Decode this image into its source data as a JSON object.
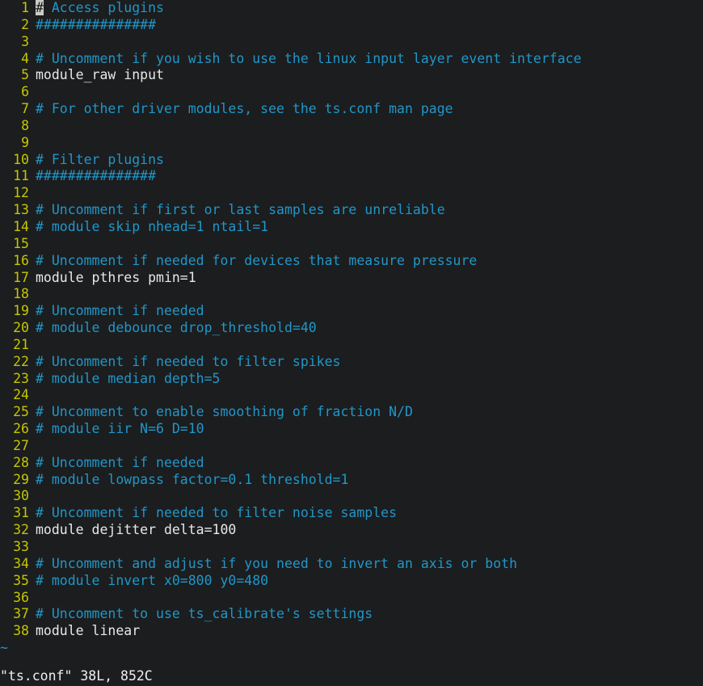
{
  "terminal": {
    "background_color": "#1b1d1e",
    "foreground_color": "#e8e8e8",
    "linenumber_color": "#c6c600",
    "comment_color": "#2196c9",
    "cursor_color": "#c9ccc7"
  },
  "editor": {
    "name": "vim",
    "cursor": {
      "line": 1,
      "column": 1,
      "character": "#"
    },
    "end_of_buffer_marker": "~",
    "lines": [
      {
        "n": "1",
        "text": "# Access plugins",
        "kind": "comment",
        "cursor_at_col": 0
      },
      {
        "n": "2",
        "text": "###############",
        "kind": "comment"
      },
      {
        "n": "3",
        "text": "",
        "kind": "empty"
      },
      {
        "n": "4",
        "text": "# Uncomment if you wish to use the linux input layer event interface",
        "kind": "comment"
      },
      {
        "n": "5",
        "text": "module_raw input",
        "kind": "code"
      },
      {
        "n": "6",
        "text": "",
        "kind": "empty"
      },
      {
        "n": "7",
        "text": "# For other driver modules, see the ts.conf man page",
        "kind": "comment"
      },
      {
        "n": "8",
        "text": "",
        "kind": "empty"
      },
      {
        "n": "9",
        "text": "",
        "kind": "empty"
      },
      {
        "n": "10",
        "text": "# Filter plugins",
        "kind": "comment"
      },
      {
        "n": "11",
        "text": "###############",
        "kind": "comment"
      },
      {
        "n": "12",
        "text": "",
        "kind": "empty"
      },
      {
        "n": "13",
        "text": "# Uncomment if first or last samples are unreliable",
        "kind": "comment"
      },
      {
        "n": "14",
        "text": "# module skip nhead=1 ntail=1",
        "kind": "comment"
      },
      {
        "n": "15",
        "text": "",
        "kind": "empty"
      },
      {
        "n": "16",
        "text": "# Uncomment if needed for devices that measure pressure",
        "kind": "comment"
      },
      {
        "n": "17",
        "text": "module pthres pmin=1",
        "kind": "code"
      },
      {
        "n": "18",
        "text": "",
        "kind": "empty"
      },
      {
        "n": "19",
        "text": "# Uncomment if needed",
        "kind": "comment"
      },
      {
        "n": "20",
        "text": "# module debounce drop_threshold=40",
        "kind": "comment"
      },
      {
        "n": "21",
        "text": "",
        "kind": "empty"
      },
      {
        "n": "22",
        "text": "# Uncomment if needed to filter spikes",
        "kind": "comment"
      },
      {
        "n": "23",
        "text": "# module median depth=5",
        "kind": "comment"
      },
      {
        "n": "24",
        "text": "",
        "kind": "empty"
      },
      {
        "n": "25",
        "text": "# Uncomment to enable smoothing of fraction N/D",
        "kind": "comment"
      },
      {
        "n": "26",
        "text": "# module iir N=6 D=10",
        "kind": "comment"
      },
      {
        "n": "27",
        "text": "",
        "kind": "empty"
      },
      {
        "n": "28",
        "text": "# Uncomment if needed",
        "kind": "comment"
      },
      {
        "n": "29",
        "text": "# module lowpass factor=0.1 threshold=1",
        "kind": "comment"
      },
      {
        "n": "30",
        "text": "",
        "kind": "empty"
      },
      {
        "n": "31",
        "text": "# Uncomment if needed to filter noise samples",
        "kind": "comment"
      },
      {
        "n": "32",
        "text": "module dejitter delta=100",
        "kind": "code"
      },
      {
        "n": "33",
        "text": "",
        "kind": "empty"
      },
      {
        "n": "34",
        "text": "# Uncomment and adjust if you need to invert an axis or both",
        "kind": "comment"
      },
      {
        "n": "35",
        "text": "# module invert x0=800 y0=480",
        "kind": "comment"
      },
      {
        "n": "36",
        "text": "",
        "kind": "empty"
      },
      {
        "n": "37",
        "text": "# Uncomment to use ts_calibrate's settings",
        "kind": "comment"
      },
      {
        "n": "38",
        "text": "module linear",
        "kind": "code"
      }
    ]
  },
  "statusline": {
    "text": "\"ts.conf\" 38L, 852C",
    "filename": "ts.conf",
    "line_count": "38L",
    "char_count": "852C"
  }
}
